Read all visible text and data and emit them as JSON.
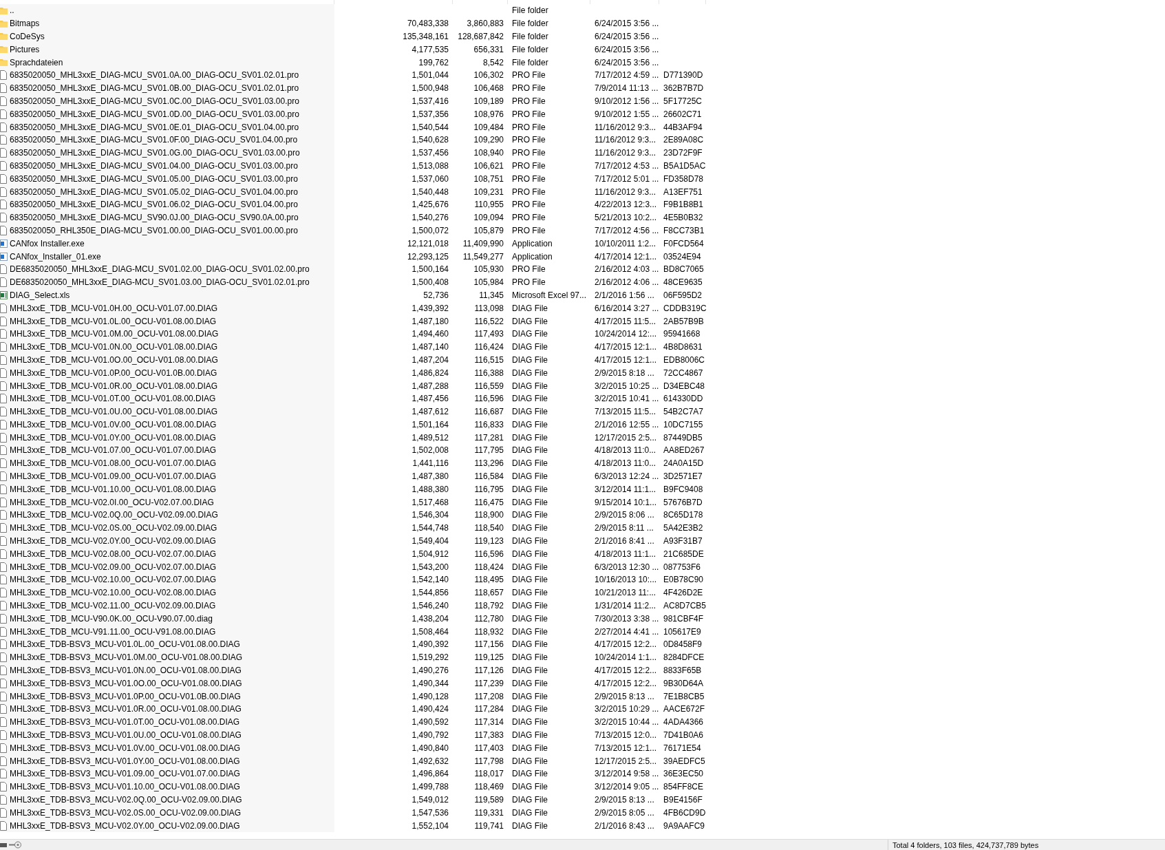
{
  "files": [
    {
      "kind": "folder",
      "column_1": "..",
      "column_4": "File folder"
    },
    {
      "kind": "folder",
      "column_1": "Bitmaps",
      "column_2": "70,483,338",
      "column_3": "3,860,883",
      "column_4": "File folder",
      "column_5": "6/24/2015 3:56 ..."
    },
    {
      "kind": "folder",
      "column_1": "CoDeSys",
      "column_2": "135,348,161",
      "column_3": "128,687,842",
      "column_4": "File folder",
      "column_5": "6/24/2015 3:56 ..."
    },
    {
      "kind": "folder",
      "column_1": "Pictures",
      "column_2": "4,177,535",
      "column_3": "656,331",
      "column_4": "File folder",
      "column_5": "6/24/2015 3:56 ..."
    },
    {
      "kind": "folder",
      "column_1": "Sprachdateien",
      "column_2": "199,762",
      "column_3": "8,542",
      "column_4": "File folder",
      "column_5": "6/24/2015 3:56 ..."
    },
    {
      "kind": "file",
      "column_1": "6835020050_MHL3xxE_DIAG-MCU_SV01.0A.00_DIAG-OCU_SV01.02.01.pro",
      "column_2": "1,501,044",
      "column_3": "106,302",
      "column_4": "PRO File",
      "column_5": "7/17/2012 4:59 ...",
      "column_6": "D771390D"
    },
    {
      "kind": "file",
      "column_1": "6835020050_MHL3xxE_DIAG-MCU_SV01.0B.00_DIAG-OCU_SV01.02.01.pro",
      "column_2": "1,500,948",
      "column_3": "106,468",
      "column_4": "PRO File",
      "column_5": "7/9/2014 11:13 ...",
      "column_6": "362B7B7D"
    },
    {
      "kind": "file",
      "column_1": "6835020050_MHL3xxE_DIAG-MCU_SV01.0C.00_DIAG-OCU_SV01.03.00.pro",
      "column_2": "1,537,416",
      "column_3": "109,189",
      "column_4": "PRO File",
      "column_5": "9/10/2012 1:56 ...",
      "column_6": "5F17725C"
    },
    {
      "kind": "file",
      "column_1": "6835020050_MHL3xxE_DIAG-MCU_SV01.0D.00_DIAG-OCU_SV01.03.00.pro",
      "column_2": "1,537,356",
      "column_3": "108,976",
      "column_4": "PRO File",
      "column_5": "9/10/2012 1:55 ...",
      "column_6": "26602C71"
    },
    {
      "kind": "file",
      "column_1": "6835020050_MHL3xxE_DIAG-MCU_SV01.0E.01_DIAG-OCU_SV01.04.00.pro",
      "column_2": "1,540,544",
      "column_3": "109,484",
      "column_4": "PRO File",
      "column_5": "11/16/2012 9:3...",
      "column_6": "44B3AF94"
    },
    {
      "kind": "file",
      "column_1": "6835020050_MHL3xxE_DIAG-MCU_SV01.0F.00_DIAG-OCU_SV01.04.00.pro",
      "column_2": "1,540,628",
      "column_3": "109,290",
      "column_4": "PRO File",
      "column_5": "11/16/2012 9:3...",
      "column_6": "2E89A08C"
    },
    {
      "kind": "file",
      "column_1": "6835020050_MHL3xxE_DIAG-MCU_SV01.0G.00_DIAG-OCU_SV01.03.00.pro",
      "column_2": "1,537,456",
      "column_3": "108,940",
      "column_4": "PRO File",
      "column_5": "11/16/2012 9:3...",
      "column_6": "23D72F9F"
    },
    {
      "kind": "file",
      "column_1": "6835020050_MHL3xxE_DIAG-MCU_SV01.04.00_DIAG-OCU_SV01.03.00.pro",
      "column_2": "1,513,088",
      "column_3": "106,621",
      "column_4": "PRO File",
      "column_5": "7/17/2012 4:53 ...",
      "column_6": "B5A1D5AC"
    },
    {
      "kind": "file",
      "column_1": "6835020050_MHL3xxE_DIAG-MCU_SV01.05.00_DIAG-OCU_SV01.03.00.pro",
      "column_2": "1,537,060",
      "column_3": "108,751",
      "column_4": "PRO File",
      "column_5": "7/17/2012 5:01 ...",
      "column_6": "FD358D78"
    },
    {
      "kind": "file",
      "column_1": "6835020050_MHL3xxE_DIAG-MCU_SV01.05.02_DIAG-OCU_SV01.04.00.pro",
      "column_2": "1,540,448",
      "column_3": "109,231",
      "column_4": "PRO File",
      "column_5": "11/16/2012 9:3...",
      "column_6": "A13EF751"
    },
    {
      "kind": "file",
      "column_1": "6835020050_MHL3xxE_DIAG-MCU_SV01.06.02_DIAG-OCU_SV01.04.00.pro",
      "column_2": "1,425,676",
      "column_3": "110,955",
      "column_4": "PRO File",
      "column_5": "4/22/2013 12:3...",
      "column_6": "F9B1B8B1"
    },
    {
      "kind": "file",
      "column_1": "6835020050_MHL3xxE_DIAG-MCU_SV90.0J.00_DIAG-OCU_SV90.0A.00.pro",
      "column_2": "1,540,276",
      "column_3": "109,094",
      "column_4": "PRO File",
      "column_5": "5/21/2013 10:2...",
      "column_6": "4E5B0B32"
    },
    {
      "kind": "file",
      "column_1": "6835020050_RHL350E_DIAG-MCU_SV01.00.00_DIAG-OCU_SV01.00.00.pro",
      "column_2": "1,500,072",
      "column_3": "105,879",
      "column_4": "PRO File",
      "column_5": "7/17/2012 4:56 ...",
      "column_6": "F8CC73B1"
    },
    {
      "kind": "application",
      "column_1": "CANfox Installer.exe",
      "column_2": "12,121,018",
      "column_3": "11,409,990",
      "column_4": "Application",
      "column_5": "10/10/2011 1:2...",
      "column_6": "F0FCD564"
    },
    {
      "kind": "application",
      "column_1": "CANfox_Installer_01.exe",
      "column_2": "12,293,125",
      "column_3": "11,549,277",
      "column_4": "Application",
      "column_5": "4/17/2014 12:1...",
      "column_6": "03524E94"
    },
    {
      "kind": "file",
      "column_1": "DE6835020050_MHL3xxE_DIAG-MCU_SV01.02.00_DIAG-OCU_SV01.02.00.pro",
      "column_2": "1,500,164",
      "column_3": "105,930",
      "column_4": "PRO File",
      "column_5": "2/16/2012 4:03 ...",
      "column_6": "BD8C7065"
    },
    {
      "kind": "file",
      "column_1": "DE6835020050_MHL3xxE_DIAG-MCU_SV01.03.00_DIAG-OCU_SV01.02.01.pro",
      "column_2": "1,500,408",
      "column_3": "105,984",
      "column_4": "PRO File",
      "column_5": "2/16/2012 4:06 ...",
      "column_6": "48CE9635"
    },
    {
      "kind": "spreadsheet",
      "column_1": "DIAG_Select.xls",
      "column_2": "52,736",
      "column_3": "11,345",
      "column_4": "Microsoft Excel 97...",
      "column_5": "2/1/2016 1:56 ...",
      "column_6": "06F595D2"
    },
    {
      "kind": "file",
      "column_1": "MHL3xxE_TDB_MCU-V01.0H.00_OCU-V01.07.00.DIAG",
      "column_2": "1,439,392",
      "column_3": "113,098",
      "column_4": "DIAG File",
      "column_5": "6/16/2014 3:27 ...",
      "column_6": "CDDB319C"
    },
    {
      "kind": "file",
      "column_1": "MHL3xxE_TDB_MCU-V01.0L.00_OCU-V01.08.00.DIAG",
      "column_2": "1,487,180",
      "column_3": "116,522",
      "column_4": "DIAG File",
      "column_5": "4/17/2015 11:5...",
      "column_6": "2AB57B9B"
    },
    {
      "kind": "file",
      "column_1": "MHL3xxE_TDB_MCU-V01.0M.00_OCU-V01.08.00.DIAG",
      "column_2": "1,494,460",
      "column_3": "117,493",
      "column_4": "DIAG File",
      "column_5": "10/24/2014 12:...",
      "column_6": "95941668"
    },
    {
      "kind": "file",
      "column_1": "MHL3xxE_TDB_MCU-V01.0N.00_OCU-V01.08.00.DIAG",
      "column_2": "1,487,140",
      "column_3": "116,424",
      "column_4": "DIAG File",
      "column_5": "4/17/2015 12:1...",
      "column_6": "4B8D8631"
    },
    {
      "kind": "file",
      "column_1": "MHL3xxE_TDB_MCU-V01.0O.00_OCU-V01.08.00.DIAG",
      "column_2": "1,487,204",
      "column_3": "116,515",
      "column_4": "DIAG File",
      "column_5": "4/17/2015 12:1...",
      "column_6": "EDB8006C"
    },
    {
      "kind": "file",
      "column_1": "MHL3xxE_TDB_MCU-V01.0P.00_OCU-V01.0B.00.DIAG",
      "column_2": "1,486,824",
      "column_3": "116,388",
      "column_4": "DIAG File",
      "column_5": "2/9/2015 8:18 ...",
      "column_6": "72CC4867"
    },
    {
      "kind": "file",
      "column_1": "MHL3xxE_TDB_MCU-V01.0R.00_OCU-V01.08.00.DIAG",
      "column_2": "1,487,288",
      "column_3": "116,559",
      "column_4": "DIAG File",
      "column_5": "3/2/2015 10:25 ...",
      "column_6": "D34EBC48"
    },
    {
      "kind": "file",
      "column_1": "MHL3xxE_TDB_MCU-V01.0T.00_OCU-V01.08.00.DIAG",
      "column_2": "1,487,456",
      "column_3": "116,596",
      "column_4": "DIAG File",
      "column_5": "3/2/2015 10:41 ...",
      "column_6": "614330DD"
    },
    {
      "kind": "file",
      "column_1": "MHL3xxE_TDB_MCU-V01.0U.00_OCU-V01.08.00.DIAG",
      "column_2": "1,487,612",
      "column_3": "116,687",
      "column_4": "DIAG File",
      "column_5": "7/13/2015 11:5...",
      "column_6": "54B2C7A7"
    },
    {
      "kind": "file",
      "column_1": "MHL3xxE_TDB_MCU-V01.0V.00_OCU-V01.08.00.DIAG",
      "column_2": "1,501,164",
      "column_3": "116,833",
      "column_4": "DIAG File",
      "column_5": "2/1/2016 12:55 ...",
      "column_6": "10DC7155"
    },
    {
      "kind": "file",
      "column_1": "MHL3xxE_TDB_MCU-V01.0Y.00_OCU-V01.08.00.DIAG",
      "column_2": "1,489,512",
      "column_3": "117,281",
      "column_4": "DIAG File",
      "column_5": "12/17/2015 2:5...",
      "column_6": "87449DB5"
    },
    {
      "kind": "file",
      "column_1": "MHL3xxE_TDB_MCU-V01.07.00_OCU-V01.07.00.DIAG",
      "column_2": "1,502,008",
      "column_3": "117,795",
      "column_4": "DIAG File",
      "column_5": "4/18/2013 11:0...",
      "column_6": "AA8ED267"
    },
    {
      "kind": "file",
      "column_1": "MHL3xxE_TDB_MCU-V01.08.00_OCU-V01.07.00.DIAG",
      "column_2": "1,441,116",
      "column_3": "113,296",
      "column_4": "DIAG File",
      "column_5": "4/18/2013 11:0...",
      "column_6": "24A0A15D"
    },
    {
      "kind": "file",
      "column_1": "MHL3xxE_TDB_MCU-V01.09.00_OCU-V01.07.00.DIAG",
      "column_2": "1,487,380",
      "column_3": "116,584",
      "column_4": "DIAG File",
      "column_5": "6/3/2013 12:24 ...",
      "column_6": "3D2571E7"
    },
    {
      "kind": "file",
      "column_1": "MHL3xxE_TDB_MCU-V01.10.00_OCU-V01.08.00.DIAG",
      "column_2": "1,488,380",
      "column_3": "116,795",
      "column_4": "DIAG File",
      "column_5": "3/12/2014 11:1...",
      "column_6": "B9FC9408"
    },
    {
      "kind": "file",
      "column_1": "MHL3xxE_TDB_MCU-V02.0I.00_OCU-V02.07.00.DIAG",
      "column_2": "1,517,468",
      "column_3": "116,475",
      "column_4": "DIAG File",
      "column_5": "9/15/2014 10:1...",
      "column_6": "57676B7D"
    },
    {
      "kind": "file",
      "column_1": "MHL3xxE_TDB_MCU-V02.0Q.00_OCU-V02.09.00.DIAG",
      "column_2": "1,546,304",
      "column_3": "118,900",
      "column_4": "DIAG File",
      "column_5": "2/9/2015 8:06 ...",
      "column_6": "8C65D178"
    },
    {
      "kind": "file",
      "column_1": "MHL3xxE_TDB_MCU-V02.0S.00_OCU-V02.09.00.DIAG",
      "column_2": "1,544,748",
      "column_3": "118,540",
      "column_4": "DIAG File",
      "column_5": "2/9/2015 8:11 ...",
      "column_6": "5A42E3B2"
    },
    {
      "kind": "file",
      "column_1": "MHL3xxE_TDB_MCU-V02.0Y.00_OCU-V02.09.00.DIAG",
      "column_2": "1,549,404",
      "column_3": "119,123",
      "column_4": "DIAG File",
      "column_5": "2/1/2016 8:41 ...",
      "column_6": "A93F31B7"
    },
    {
      "kind": "file",
      "column_1": "MHL3xxE_TDB_MCU-V02.08.00_OCU-V02.07.00.DIAG",
      "column_2": "1,504,912",
      "column_3": "116,596",
      "column_4": "DIAG File",
      "column_5": "4/18/2013 11:1...",
      "column_6": "21C685DE"
    },
    {
      "kind": "file",
      "column_1": "MHL3xxE_TDB_MCU-V02.09.00_OCU-V02.07.00.DIAG",
      "column_2": "1,543,200",
      "column_3": "118,424",
      "column_4": "DIAG File",
      "column_5": "6/3/2013 12:30 ...",
      "column_6": "087753F6"
    },
    {
      "kind": "file",
      "column_1": "MHL3xxE_TDB_MCU-V02.10.00_OCU-V02.07.00.DIAG",
      "column_2": "1,542,140",
      "column_3": "118,495",
      "column_4": "DIAG File",
      "column_5": "10/16/2013 10:...",
      "column_6": "E0B78C90"
    },
    {
      "kind": "file",
      "column_1": "MHL3xxE_TDB_MCU-V02.10.00_OCU-V02.08.00.DIAG",
      "column_2": "1,544,856",
      "column_3": "118,657",
      "column_4": "DIAG File",
      "column_5": "10/21/2013 11:...",
      "column_6": "4F426D2E"
    },
    {
      "kind": "file",
      "column_1": "MHL3xxE_TDB_MCU-V02.11.00_OCU-V02.09.00.DIAG",
      "column_2": "1,546,240",
      "column_3": "118,792",
      "column_4": "DIAG File",
      "column_5": "1/31/2014 11:2...",
      "column_6": "AC8D7CB5"
    },
    {
      "kind": "file",
      "column_1": "MHL3xxE_TDB_MCU-V90.0K.00_OCU-V90.07.00.diag",
      "column_2": "1,438,204",
      "column_3": "112,780",
      "column_4": "DIAG File",
      "column_5": "7/30/2013 3:38 ...",
      "column_6": "981CBF4F"
    },
    {
      "kind": "file",
      "column_1": "MHL3xxE_TDB_MCU-V91.11.00_OCU-V91.08.00.DIAG",
      "column_2": "1,508,464",
      "column_3": "118,932",
      "column_4": "DIAG File",
      "column_5": "2/27/2014 4:41 ...",
      "column_6": "105617E9"
    },
    {
      "kind": "file",
      "column_1": "MHL3xxE_TDB-BSV3_MCU-V01.0L.00_OCU-V01.08.00.DIAG",
      "column_2": "1,490,392",
      "column_3": "117,156",
      "column_4": "DIAG File",
      "column_5": "4/17/2015 12:2...",
      "column_6": "0D8458F9"
    },
    {
      "kind": "file",
      "column_1": "MHL3xxE_TDB-BSV3_MCU-V01.0M.00_OCU-V01.08.00.DIAG",
      "column_2": "1,519,292",
      "column_3": "119,125",
      "column_4": "DIAG File",
      "column_5": "10/24/2014 1:1...",
      "column_6": "8284DFCE"
    },
    {
      "kind": "file",
      "column_1": "MHL3xxE_TDB-BSV3_MCU-V01.0N.00_OCU-V01.08.00.DIAG",
      "column_2": "1,490,276",
      "column_3": "117,126",
      "column_4": "DIAG File",
      "column_5": "4/17/2015 12:2...",
      "column_6": "8833F65B"
    },
    {
      "kind": "file",
      "column_1": "MHL3xxE_TDB-BSV3_MCU-V01.0O.00_OCU-V01.08.00.DIAG",
      "column_2": "1,490,344",
      "column_3": "117,239",
      "column_4": "DIAG File",
      "column_5": "4/17/2015 12:2...",
      "column_6": "9B30D64A"
    },
    {
      "kind": "file",
      "column_1": "MHL3xxE_TDB-BSV3_MCU-V01.0P.00_OCU-V01.0B.00.DIAG",
      "column_2": "1,490,128",
      "column_3": "117,208",
      "column_4": "DIAG File",
      "column_5": "2/9/2015 8:13 ...",
      "column_6": "7E1B8CB5"
    },
    {
      "kind": "file",
      "column_1": "MHL3xxE_TDB-BSV3_MCU-V01.0R.00_OCU-V01.08.00.DIAG",
      "column_2": "1,490,424",
      "column_3": "117,284",
      "column_4": "DIAG File",
      "column_5": "3/2/2015 10:29 ...",
      "column_6": "AACE672F"
    },
    {
      "kind": "file",
      "column_1": "MHL3xxE_TDB-BSV3_MCU-V01.0T.00_OCU-V01.08.00.DIAG",
      "column_2": "1,490,592",
      "column_3": "117,314",
      "column_4": "DIAG File",
      "column_5": "3/2/2015 10:44 ...",
      "column_6": "4ADA4366"
    },
    {
      "kind": "file",
      "column_1": "MHL3xxE_TDB-BSV3_MCU-V01.0U.00_OCU-V01.08.00.DIAG",
      "column_2": "1,490,792",
      "column_3": "117,383",
      "column_4": "DIAG File",
      "column_5": "7/13/2015 12:0...",
      "column_6": "7D41B0A6"
    },
    {
      "kind": "file",
      "column_1": "MHL3xxE_TDB-BSV3_MCU-V01.0V.00_OCU-V01.08.00.DIAG",
      "column_2": "1,490,840",
      "column_3": "117,403",
      "column_4": "DIAG File",
      "column_5": "7/13/2015 12:1...",
      "column_6": "76171E54"
    },
    {
      "kind": "file",
      "column_1": "MHL3xxE_TDB-BSV3_MCU-V01.0Y.00_OCU-V01.08.00.DIAG",
      "column_2": "1,492,632",
      "column_3": "117,798",
      "column_4": "DIAG File",
      "column_5": "12/17/2015 2:5...",
      "column_6": "39AEDFC5"
    },
    {
      "kind": "file",
      "column_1": "MHL3xxE_TDB-BSV3_MCU-V01.09.00_OCU-V01.07.00.DIAG",
      "column_2": "1,496,864",
      "column_3": "118,017",
      "column_4": "DIAG File",
      "column_5": "3/12/2014 9:58 ...",
      "column_6": "36E3EC50"
    },
    {
      "kind": "file",
      "column_1": "MHL3xxE_TDB-BSV3_MCU-V01.10.00_OCU-V01.08.00.DIAG",
      "column_2": "1,499,788",
      "column_3": "118,469",
      "column_4": "DIAG File",
      "column_5": "3/12/2014 9:05 ...",
      "column_6": "854FF8CE"
    },
    {
      "kind": "file",
      "column_1": "MHL3xxE_TDB-BSV3_MCU-V02.0Q.00_OCU-V02.09.00.DIAG",
      "column_2": "1,549,012",
      "column_3": "119,589",
      "column_4": "DIAG File",
      "column_5": "2/9/2015 8:13 ...",
      "column_6": "B9E4156F"
    },
    {
      "kind": "file",
      "column_1": "MHL3xxE_TDB-BSV3_MCU-V02.0S.00_OCU-V02.09.00.DIAG",
      "column_2": "1,547,536",
      "column_3": "119,331",
      "column_4": "DIAG File",
      "column_5": "2/9/2015 8:05 ...",
      "column_6": "4FB6CD9D"
    },
    {
      "kind": "file",
      "column_1": "MHL3xxE_TDB-BSV3_MCU-V02.0Y.00_OCU-V02.09.00.DIAG",
      "column_2": "1,552,104",
      "column_3": "119,741",
      "column_4": "DIAG File",
      "column_5": "2/1/2016 8:43 ...",
      "column_6": "9A9AAFC9"
    }
  ],
  "status_bar": {
    "summary": "Total 4 folders, 103 files, 424,737,789 bytes"
  }
}
